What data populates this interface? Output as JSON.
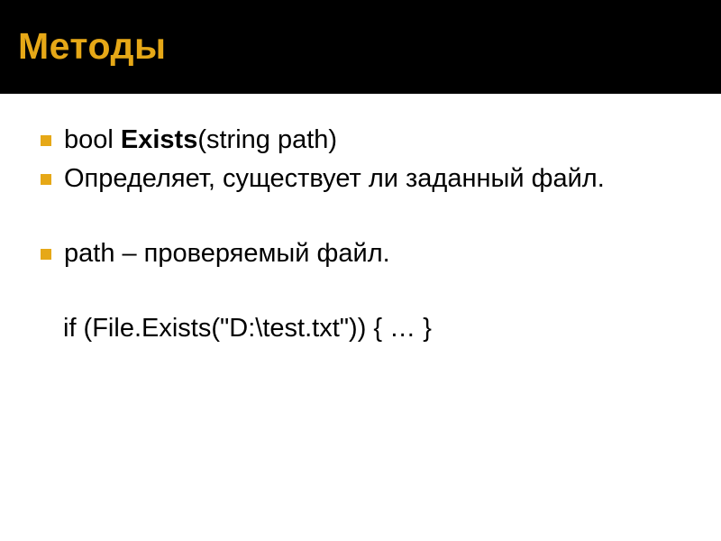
{
  "header": {
    "title": "Методы"
  },
  "items": [
    {
      "prefix": "bool ",
      "bold": "Exists",
      "suffix": "(string path)"
    },
    {
      "text": "Определяет, существует ли заданный файл."
    },
    {
      "text": "path – проверяемый файл."
    }
  ],
  "code_line": "if (File.Exists(\"D:\\test.txt\"))    { … }"
}
